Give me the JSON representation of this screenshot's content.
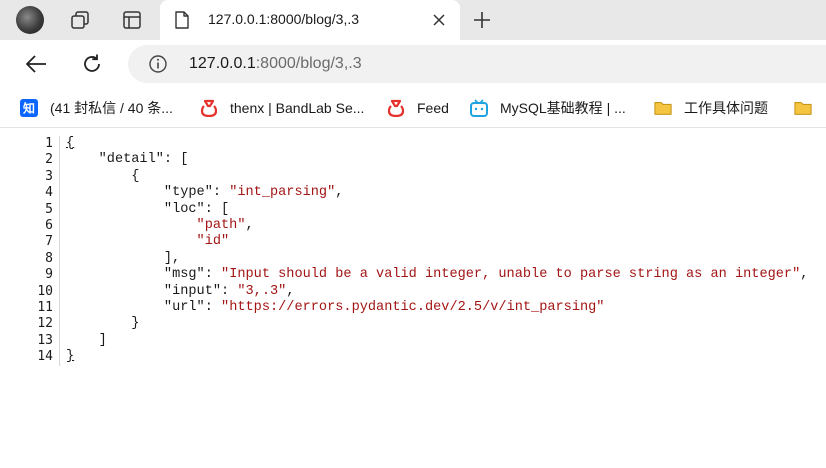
{
  "tabs": [
    {
      "title": "127.0.0.1:8000/blog/3,.3",
      "favicon": "document-icon",
      "active": true
    }
  ],
  "tabstrip": {
    "new_tab_label": "+"
  },
  "address_bar": {
    "url_host": "127.0.0.1",
    "url_rest": ":8000/blog/3,.3"
  },
  "bookmarks": [
    {
      "label": "(41 封私信 / 40 条...",
      "icon": "zhihu-icon"
    },
    {
      "label": "thenx | BandLab Se...",
      "icon": "bandlab-icon"
    },
    {
      "label": "Feed",
      "icon": "bandlab-icon"
    },
    {
      "label": "MySQL基础教程 | ...",
      "icon": "bilibili-icon"
    },
    {
      "label": "工作具体问题",
      "icon": "folder-icon"
    }
  ],
  "json_view": {
    "line_numbers": [
      "1",
      "2",
      "3",
      "4",
      "5",
      "6",
      "7",
      "8",
      "9",
      "10",
      "11",
      "12",
      "13",
      "14"
    ],
    "detail_key": "detail",
    "type_key": "type",
    "type_value": "int_parsing",
    "loc_key": "loc",
    "loc_items": [
      "path",
      "id"
    ],
    "msg_key": "msg",
    "msg_value": "Input should be a valid integer, unable to parse string as an integer",
    "input_key": "input",
    "input_value": "3,.3",
    "url_key": "url",
    "url_value": "https://errors.pydantic.dev/2.5/v/int_parsing"
  },
  "colors": {
    "tabstrip_bg": "#e8e8e8",
    "json_string": "#a31515",
    "json_key": "#1a1a1a"
  }
}
